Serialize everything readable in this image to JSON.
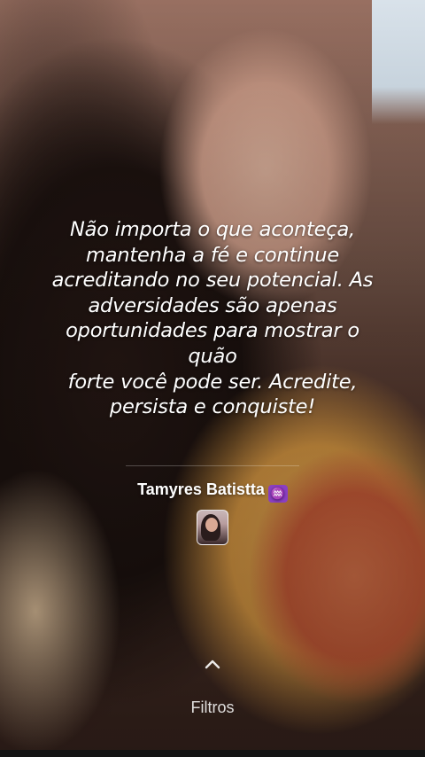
{
  "quote": {
    "lines": [
      "Não importa o que aconteça,",
      "mantenha a fé e continue",
      "acreditando no seu potencial. As",
      "adversidades são apenas",
      "oportunidades para mostrar o quão",
      "forte você pode ser. Acredite,",
      "persista e conquiste!"
    ]
  },
  "author": {
    "name": "Tamyres Batistta",
    "sign": "♒"
  },
  "filters": {
    "label": "Filtros"
  },
  "colors": {
    "sign_badge": "#8b3fc3"
  }
}
